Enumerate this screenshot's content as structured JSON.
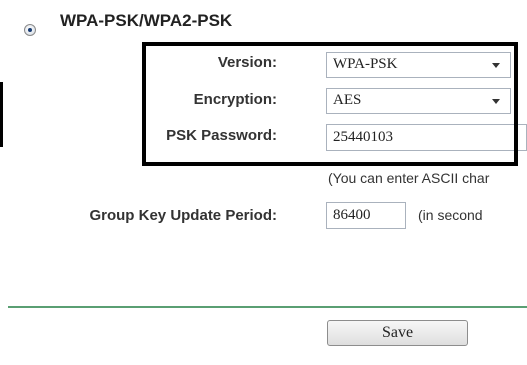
{
  "security": {
    "mode_label": "WPA-PSK/WPA2-PSK",
    "version": {
      "label": "Version:",
      "value": "WPA-PSK"
    },
    "encryption": {
      "label": "Encryption:",
      "value": "AES"
    },
    "psk_password": {
      "label": "PSK Password:",
      "value": "25440103",
      "hint": "(You can enter ASCII char"
    },
    "group_key": {
      "label": "Group Key Update Period:",
      "value": "86400",
      "unit": "(in second"
    }
  },
  "actions": {
    "save_label": "Save"
  },
  "colors": {
    "divider": "#5a9f73",
    "highlight_border": "#000000"
  }
}
